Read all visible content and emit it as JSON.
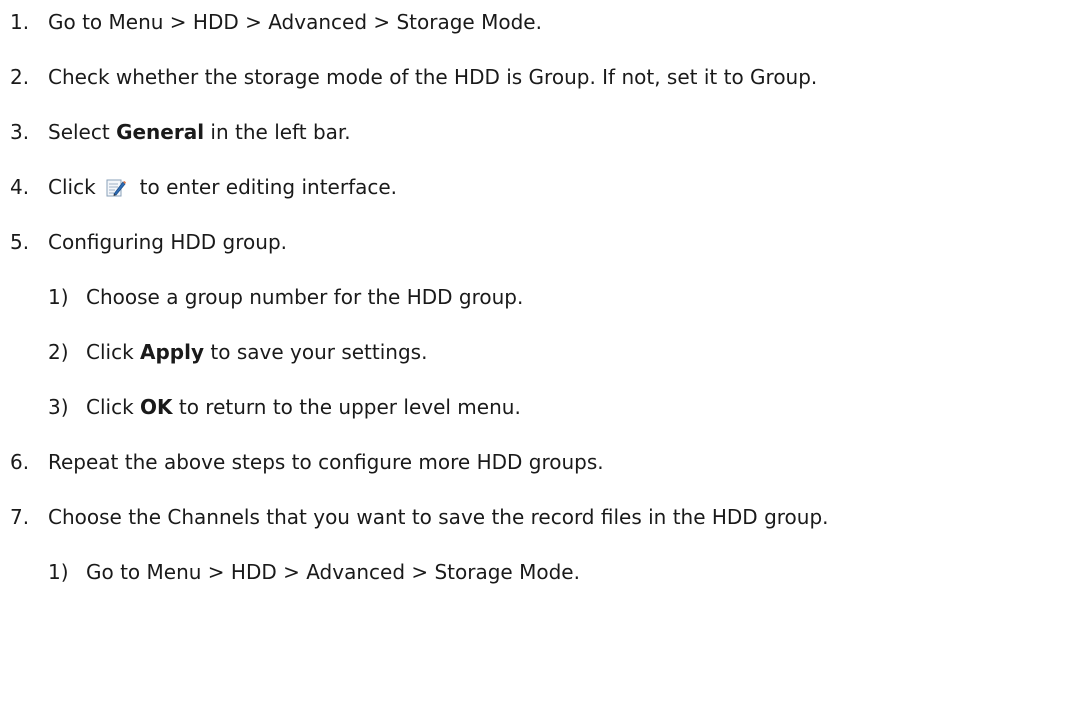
{
  "steps": [
    {
      "num": "1.",
      "text": "Go to Menu > HDD > Advanced > Storage Mode."
    },
    {
      "num": "2.",
      "text": "Check whether the storage mode of the HDD is Group. If not, set it to Group."
    },
    {
      "num": "3.",
      "pre": "Select ",
      "bold": "General",
      "post": " in the left bar."
    },
    {
      "num": "4.",
      "pre": "Click",
      "icon": "edit-icon",
      "post": "to enter editing interface."
    },
    {
      "num": "5.",
      "text": "Configuring HDD group."
    },
    {
      "num": "6.",
      "text": "Repeat the above steps to configure more HDD groups."
    },
    {
      "num": "7.",
      "text": "Choose the Channels that you want to save the record files in the HDD group."
    }
  ],
  "substeps_5": [
    {
      "num": "1)",
      "text": "Choose a group number for the HDD group."
    },
    {
      "num": "2)",
      "pre": "Click ",
      "bold": "Apply",
      "post": " to save your settings."
    },
    {
      "num": "3)",
      "pre": "Click ",
      "bold": "OK",
      "post": " to return to the upper level menu."
    }
  ],
  "substeps_7": [
    {
      "num": "1)",
      "text": "Go to Menu > HDD > Advanced > Storage Mode."
    }
  ]
}
